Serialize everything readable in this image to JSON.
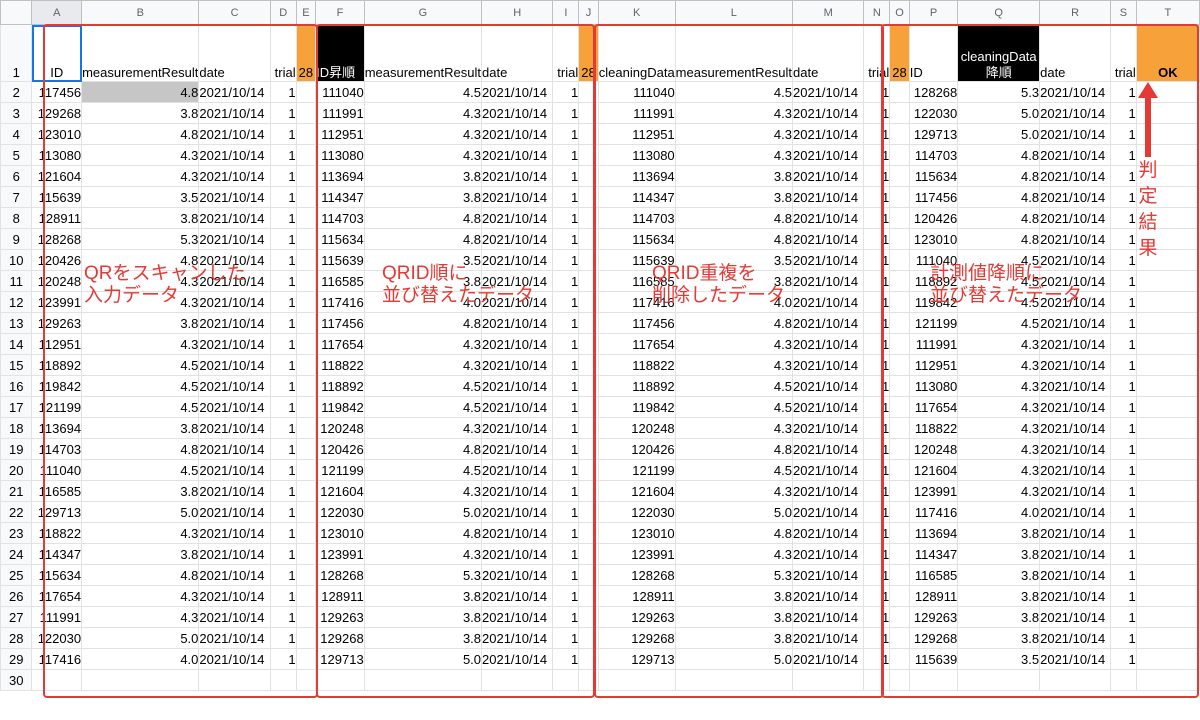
{
  "colors": {
    "accent_orange": "#f6a13a",
    "group_border": "#e53935",
    "selection": "#1a73e8"
  },
  "columns": [
    "A",
    "B",
    "C",
    "D",
    "E",
    "F",
    "G",
    "H",
    "I",
    "J",
    "K",
    "L",
    "M",
    "N",
    "O",
    "P",
    "Q",
    "R",
    "S",
    "T"
  ],
  "header": {
    "id": "ID",
    "measurement": "measurementResult",
    "date": "date",
    "trial": "trial",
    "count": "28",
    "id_sorted": "ID昇順",
    "cleaning_data": "cleaningData",
    "cleaning_data_desc": "cleaningData降順",
    "result": "OK"
  },
  "row_numbers": [
    "1",
    "2",
    "3",
    "4",
    "5",
    "6",
    "7",
    "8",
    "9",
    "10",
    "11",
    "12",
    "13",
    "14",
    "15",
    "16",
    "17",
    "18",
    "19",
    "20",
    "21",
    "22",
    "23",
    "24",
    "25",
    "26",
    "27",
    "28",
    "29",
    "30"
  ],
  "input_data": [
    [
      "117456",
      "4.8",
      "2021/10/14",
      "1"
    ],
    [
      "129268",
      "3.8",
      "2021/10/14",
      "1"
    ],
    [
      "123010",
      "4.8",
      "2021/10/14",
      "1"
    ],
    [
      "113080",
      "4.3",
      "2021/10/14",
      "1"
    ],
    [
      "121604",
      "4.3",
      "2021/10/14",
      "1"
    ],
    [
      "115639",
      "3.5",
      "2021/10/14",
      "1"
    ],
    [
      "128911",
      "3.8",
      "2021/10/14",
      "1"
    ],
    [
      "128268",
      "5.3",
      "2021/10/14",
      "1"
    ],
    [
      "120426",
      "4.8",
      "2021/10/14",
      "1"
    ],
    [
      "120248",
      "4.3",
      "2021/10/14",
      "1"
    ],
    [
      "123991",
      "4.3",
      "2021/10/14",
      "1"
    ],
    [
      "129263",
      "3.8",
      "2021/10/14",
      "1"
    ],
    [
      "112951",
      "4.3",
      "2021/10/14",
      "1"
    ],
    [
      "118892",
      "4.5",
      "2021/10/14",
      "1"
    ],
    [
      "119842",
      "4.5",
      "2021/10/14",
      "1"
    ],
    [
      "121199",
      "4.5",
      "2021/10/14",
      "1"
    ],
    [
      "113694",
      "3.8",
      "2021/10/14",
      "1"
    ],
    [
      "114703",
      "4.8",
      "2021/10/14",
      "1"
    ],
    [
      "111040",
      "4.5",
      "2021/10/14",
      "1"
    ],
    [
      "116585",
      "3.8",
      "2021/10/14",
      "1"
    ],
    [
      "129713",
      "5.0",
      "2021/10/14",
      "1"
    ],
    [
      "118822",
      "4.3",
      "2021/10/14",
      "1"
    ],
    [
      "114347",
      "3.8",
      "2021/10/14",
      "1"
    ],
    [
      "115634",
      "4.8",
      "2021/10/14",
      "1"
    ],
    [
      "117654",
      "4.3",
      "2021/10/14",
      "1"
    ],
    [
      "111991",
      "4.3",
      "2021/10/14",
      "1"
    ],
    [
      "122030",
      "5.0",
      "2021/10/14",
      "1"
    ],
    [
      "117416",
      "4.0",
      "2021/10/14",
      "1"
    ]
  ],
  "sorted_data": [
    [
      "111040",
      "4.5",
      "2021/10/14",
      "1"
    ],
    [
      "111991",
      "4.3",
      "2021/10/14",
      "1"
    ],
    [
      "112951",
      "4.3",
      "2021/10/14",
      "1"
    ],
    [
      "113080",
      "4.3",
      "2021/10/14",
      "1"
    ],
    [
      "113694",
      "3.8",
      "2021/10/14",
      "1"
    ],
    [
      "114347",
      "3.8",
      "2021/10/14",
      "1"
    ],
    [
      "114703",
      "4.8",
      "2021/10/14",
      "1"
    ],
    [
      "115634",
      "4.8",
      "2021/10/14",
      "1"
    ],
    [
      "115639",
      "3.5",
      "2021/10/14",
      "1"
    ],
    [
      "116585",
      "3.8",
      "2021/10/14",
      "1"
    ],
    [
      "117416",
      "4.0",
      "2021/10/14",
      "1"
    ],
    [
      "117456",
      "4.8",
      "2021/10/14",
      "1"
    ],
    [
      "117654",
      "4.3",
      "2021/10/14",
      "1"
    ],
    [
      "118822",
      "4.3",
      "2021/10/14",
      "1"
    ],
    [
      "118892",
      "4.5",
      "2021/10/14",
      "1"
    ],
    [
      "119842",
      "4.5",
      "2021/10/14",
      "1"
    ],
    [
      "120248",
      "4.3",
      "2021/10/14",
      "1"
    ],
    [
      "120426",
      "4.8",
      "2021/10/14",
      "1"
    ],
    [
      "121199",
      "4.5",
      "2021/10/14",
      "1"
    ],
    [
      "121604",
      "4.3",
      "2021/10/14",
      "1"
    ],
    [
      "122030",
      "5.0",
      "2021/10/14",
      "1"
    ],
    [
      "123010",
      "4.8",
      "2021/10/14",
      "1"
    ],
    [
      "123991",
      "4.3",
      "2021/10/14",
      "1"
    ],
    [
      "128268",
      "5.3",
      "2021/10/14",
      "1"
    ],
    [
      "128911",
      "3.8",
      "2021/10/14",
      "1"
    ],
    [
      "129263",
      "3.8",
      "2021/10/14",
      "1"
    ],
    [
      "129268",
      "3.8",
      "2021/10/14",
      "1"
    ],
    [
      "129713",
      "5.0",
      "2021/10/14",
      "1"
    ]
  ],
  "dedup_data": [
    [
      "111040",
      "4.5",
      "2021/10/14",
      "1"
    ],
    [
      "111991",
      "4.3",
      "2021/10/14",
      "1"
    ],
    [
      "112951",
      "4.3",
      "2021/10/14",
      "1"
    ],
    [
      "113080",
      "4.3",
      "2021/10/14",
      "1"
    ],
    [
      "113694",
      "3.8",
      "2021/10/14",
      "1"
    ],
    [
      "114347",
      "3.8",
      "2021/10/14",
      "1"
    ],
    [
      "114703",
      "4.8",
      "2021/10/14",
      "1"
    ],
    [
      "115634",
      "4.8",
      "2021/10/14",
      "1"
    ],
    [
      "115639",
      "3.5",
      "2021/10/14",
      "1"
    ],
    [
      "116585",
      "3.8",
      "2021/10/14",
      "1"
    ],
    [
      "117416",
      "4.0",
      "2021/10/14",
      "1"
    ],
    [
      "117456",
      "4.8",
      "2021/10/14",
      "1"
    ],
    [
      "117654",
      "4.3",
      "2021/10/14",
      "1"
    ],
    [
      "118822",
      "4.3",
      "2021/10/14",
      "1"
    ],
    [
      "118892",
      "4.5",
      "2021/10/14",
      "1"
    ],
    [
      "119842",
      "4.5",
      "2021/10/14",
      "1"
    ],
    [
      "120248",
      "4.3",
      "2021/10/14",
      "1"
    ],
    [
      "120426",
      "4.8",
      "2021/10/14",
      "1"
    ],
    [
      "121199",
      "4.5",
      "2021/10/14",
      "1"
    ],
    [
      "121604",
      "4.3",
      "2021/10/14",
      "1"
    ],
    [
      "122030",
      "5.0",
      "2021/10/14",
      "1"
    ],
    [
      "123010",
      "4.8",
      "2021/10/14",
      "1"
    ],
    [
      "123991",
      "4.3",
      "2021/10/14",
      "1"
    ],
    [
      "128268",
      "5.3",
      "2021/10/14",
      "1"
    ],
    [
      "128911",
      "3.8",
      "2021/10/14",
      "1"
    ],
    [
      "129263",
      "3.8",
      "2021/10/14",
      "1"
    ],
    [
      "129268",
      "3.8",
      "2021/10/14",
      "1"
    ],
    [
      "129713",
      "5.0",
      "2021/10/14",
      "1"
    ]
  ],
  "desc_data": [
    [
      "128268",
      "5.3",
      "2021/10/14",
      "1"
    ],
    [
      "122030",
      "5.0",
      "2021/10/14",
      "1"
    ],
    [
      "129713",
      "5.0",
      "2021/10/14",
      "1"
    ],
    [
      "114703",
      "4.8",
      "2021/10/14",
      "1"
    ],
    [
      "115634",
      "4.8",
      "2021/10/14",
      "1"
    ],
    [
      "117456",
      "4.8",
      "2021/10/14",
      "1"
    ],
    [
      "120426",
      "4.8",
      "2021/10/14",
      "1"
    ],
    [
      "123010",
      "4.8",
      "2021/10/14",
      "1"
    ],
    [
      "111040",
      "4.5",
      "2021/10/14",
      "1"
    ],
    [
      "118892",
      "4.5",
      "2021/10/14",
      "1"
    ],
    [
      "119842",
      "4.5",
      "2021/10/14",
      "1"
    ],
    [
      "121199",
      "4.5",
      "2021/10/14",
      "1"
    ],
    [
      "111991",
      "4.3",
      "2021/10/14",
      "1"
    ],
    [
      "112951",
      "4.3",
      "2021/10/14",
      "1"
    ],
    [
      "113080",
      "4.3",
      "2021/10/14",
      "1"
    ],
    [
      "117654",
      "4.3",
      "2021/10/14",
      "1"
    ],
    [
      "118822",
      "4.3",
      "2021/10/14",
      "1"
    ],
    [
      "120248",
      "4.3",
      "2021/10/14",
      "1"
    ],
    [
      "121604",
      "4.3",
      "2021/10/14",
      "1"
    ],
    [
      "123991",
      "4.3",
      "2021/10/14",
      "1"
    ],
    [
      "117416",
      "4.0",
      "2021/10/14",
      "1"
    ],
    [
      "113694",
      "3.8",
      "2021/10/14",
      "1"
    ],
    [
      "114347",
      "3.8",
      "2021/10/14",
      "1"
    ],
    [
      "116585",
      "3.8",
      "2021/10/14",
      "1"
    ],
    [
      "128911",
      "3.8",
      "2021/10/14",
      "1"
    ],
    [
      "129263",
      "3.8",
      "2021/10/14",
      "1"
    ],
    [
      "129268",
      "3.8",
      "2021/10/14",
      "1"
    ],
    [
      "115639",
      "3.5",
      "2021/10/14",
      "1"
    ]
  ],
  "annotations": {
    "input": "QRをスキャンした\n入力データ",
    "sorted": "QRID順に\n並び替えたデータ",
    "dedup": "QRID重複を\n削除したデータ",
    "desc": "計測値降順に\n並び替えたデータ",
    "result": "判定結果"
  }
}
